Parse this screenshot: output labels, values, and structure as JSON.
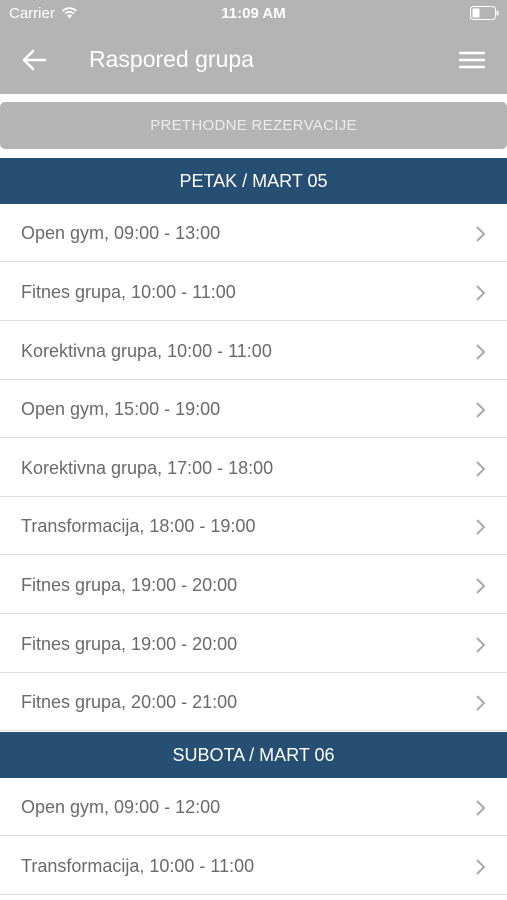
{
  "status_bar": {
    "carrier": "Carrier",
    "time": "11:09 AM"
  },
  "header": {
    "title": "Raspored grupa",
    "back_icon": "arrow-left-icon",
    "menu_icon": "hamburger-menu-icon"
  },
  "previous_reservations_label": "PRETHODNE REZERVACIJE",
  "days": [
    {
      "title": "PETAK / MART 05",
      "items": [
        "Open gym, 09:00 - 13:00",
        "Fitnes grupa, 10:00 - 11:00",
        "Korektivna grupa, 10:00 - 11:00",
        "Open gym, 15:00 - 19:00",
        "Korektivna grupa, 17:00 - 18:00",
        "Transformacija, 18:00 - 19:00",
        "Fitnes grupa, 19:00 - 20:00",
        "Fitnes grupa, 19:00 - 20:00",
        "Fitnes grupa, 20:00 - 21:00"
      ]
    },
    {
      "title": "SUBOTA / MART 06",
      "items": [
        "Open gym, 09:00 - 12:00",
        "Transformacija, 10:00 - 11:00"
      ]
    }
  ],
  "colors": {
    "header_bg": "#b4b4b4",
    "day_header_bg": "#264f73"
  }
}
